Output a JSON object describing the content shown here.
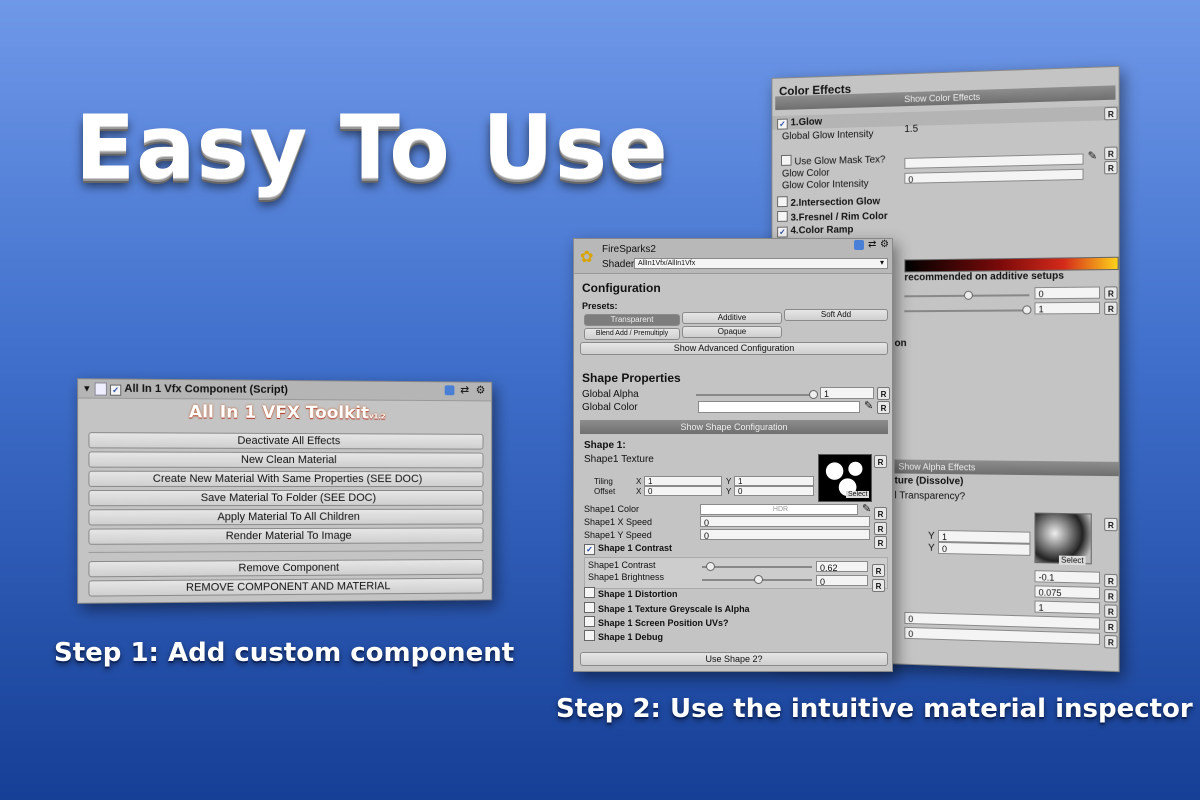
{
  "headline": "Easy To Use",
  "step1": "Step 1: Add custom component",
  "step2": "Step 2: Use the intuitive material inspector",
  "component": {
    "title": "All In 1 Vfx Component (Script)",
    "logo": "All In 1 VFX Toolkit",
    "version": "v1.2",
    "buttons": [
      "Deactivate All Effects",
      "New Clean Material",
      "Create New Material With Same Properties (SEE DOC)",
      "Save Material To Folder (SEE DOC)",
      "Apply Material To All Children",
      "Render Material To Image"
    ],
    "remove": "Remove Component",
    "remove_all": "REMOVE COMPONENT AND MATERIAL"
  },
  "back": {
    "title": "Color Effects",
    "show_bar": "Show Color Effects",
    "glow": "1.Glow",
    "glow_intensity_label": "Global Glow Intensity",
    "glow_intensity": "1.5",
    "glow_mask": "Use Glow Mask Tex?",
    "glow_color": "Glow Color",
    "glow_color_intensity": "Glow Color Intensity",
    "glow_color_intensity_val": "0",
    "intersection": "2.Intersection Glow",
    "fresnel": "3.Fresnel / Rim Color",
    "color_ramp": "4.Color Ramp",
    "recommended": "recommended on additive setups",
    "val_a": "0",
    "val_b": "1",
    "partial_on": "on",
    "show_alpha": "Show Alpha Effects",
    "dissolve": "ture (Dissolve)",
    "transparency": "l Transparency?",
    "y1": "1",
    "y0": "0",
    "v1": "-0.1",
    "v2": "0.075",
    "v3": "1",
    "v4": "0",
    "v5": "0",
    "select": "Select"
  },
  "front": {
    "material": "FireSparks2",
    "shader_label": "Shader",
    "shader": "AllIn1Vfx/AllIn1Vfx",
    "configuration": "Configuration",
    "presets": "Presets:",
    "preset_buttons": [
      "Transparent",
      "Additive",
      "Soft Add",
      "Blend Add / Premultiply",
      "Opaque"
    ],
    "advanced": "Show Advanced Configuration",
    "shape_props": "Shape Properties",
    "global_alpha": "Global Alpha",
    "global_alpha_val": "1",
    "global_color": "Global Color",
    "show_shape": "Show Shape Configuration",
    "shape1": "Shape 1:",
    "shape1_texture": "Shape1 Texture",
    "tiling": "Tiling",
    "offset": "Offset",
    "x": "X",
    "y": "Y",
    "tiling_x": "1",
    "tiling_y": "1",
    "offset_x": "0",
    "offset_y": "0",
    "select": "Select",
    "shape1_color": "Shape1 Color",
    "hdr": "HDR",
    "x_speed": "Shape1 X Speed",
    "x_speed_val": "0",
    "y_speed": "Shape1 Y Speed",
    "y_speed_val": "0",
    "contrast_toggle": "Shape 1 Contrast",
    "contrast": "Shape1 Contrast",
    "contrast_val": "0.62",
    "brightness": "Shape1 Brightness",
    "brightness_val": "0",
    "distortion": "Shape 1 Distortion",
    "greyscale": "Shape 1 Texture Greyscale Is Alpha",
    "screen_uv": "Shape 1 Screen Position UVs?",
    "debug": "Shape 1 Debug",
    "use_shape2": "Use Shape 2?"
  },
  "colors": {
    "accent_check": "#1a3fa0",
    "ramp_start": "#000000",
    "ramp_mid": "#d42a1a",
    "ramp_end": "#ffd21a"
  }
}
